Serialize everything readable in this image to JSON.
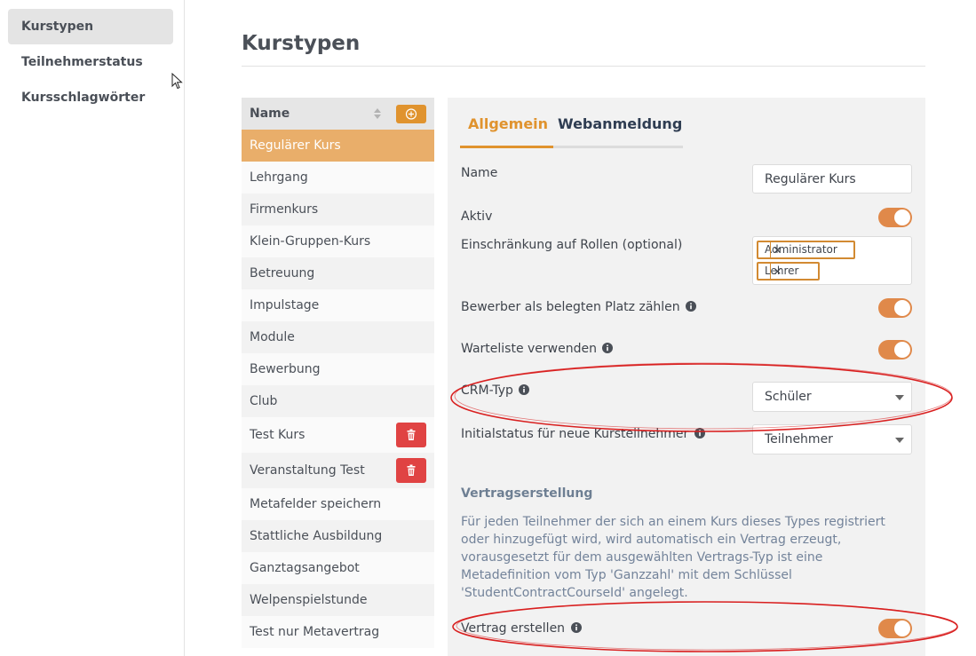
{
  "sidebar": {
    "items": [
      {
        "label": "Kurstypen",
        "active": true
      },
      {
        "label": "Teilnehmerstatus",
        "active": false
      },
      {
        "label": "Kursschlagwörter",
        "active": false
      }
    ]
  },
  "page": {
    "title": "Kurstypen"
  },
  "list": {
    "header": "Name",
    "items": [
      {
        "label": "Regulärer Kurs",
        "selected": true
      },
      {
        "label": "Lehrgang"
      },
      {
        "label": "Firmenkurs"
      },
      {
        "label": "Klein-Gruppen-Kurs"
      },
      {
        "label": "Betreuung"
      },
      {
        "label": "Impulstage"
      },
      {
        "label": "Module"
      },
      {
        "label": "Bewerbung"
      },
      {
        "label": "Club"
      },
      {
        "label": "Test Kurs",
        "deletable": true
      },
      {
        "label": "Veranstaltung Test",
        "deletable": true
      },
      {
        "label": "Metafelder speichern"
      },
      {
        "label": "Stattliche Ausbildung"
      },
      {
        "label": "Ganztagsangebot"
      },
      {
        "label": "Welpenspielstunde"
      },
      {
        "label": "Test nur Metavertrag"
      }
    ]
  },
  "tabs": [
    {
      "label": "Allgemein",
      "active": true
    },
    {
      "label": "Webanmeldung",
      "active": false
    }
  ],
  "form": {
    "name_label": "Name",
    "name_value": "Regulärer Kurs",
    "aktiv_label": "Aktiv",
    "aktiv_on": true,
    "roles_label": "Einschränkung auf Rollen (optional)",
    "roles": [
      "Administrator",
      "Lehrer"
    ],
    "bewerber_label": "Bewerber als belegten Platz zählen",
    "bewerber_on": true,
    "warteliste_label": "Warteliste verwenden",
    "warteliste_on": true,
    "crm_label": "CRM-Typ",
    "crm_value": "Schüler",
    "initial_label": "Initialstatus für neue Kursteilnehmer",
    "initial_value": "Teilnehmer",
    "vertrag_section": "Vertragserstellung",
    "vertrag_desc": "Für jeden Teilnehmer der sich an einem Kurs dieses Types registriert oder hinzugefügt wird, wird automatisch ein Vertrag erzeugt, vorausgesetzt für dem ausgewählten Vertrags-Typ ist eine Metadefinition vom Typ 'Ganzzahl' mit dem Schlüssel 'StudentContractCourseId' angelegt.",
    "vertrag_label": "Vertrag erstellen",
    "vertrag_on": true,
    "tag_remove": "×"
  },
  "colors": {
    "accent": "#e0932e",
    "toggle": "#e0894a",
    "danger": "#e04343",
    "highlight": "#d92020"
  }
}
